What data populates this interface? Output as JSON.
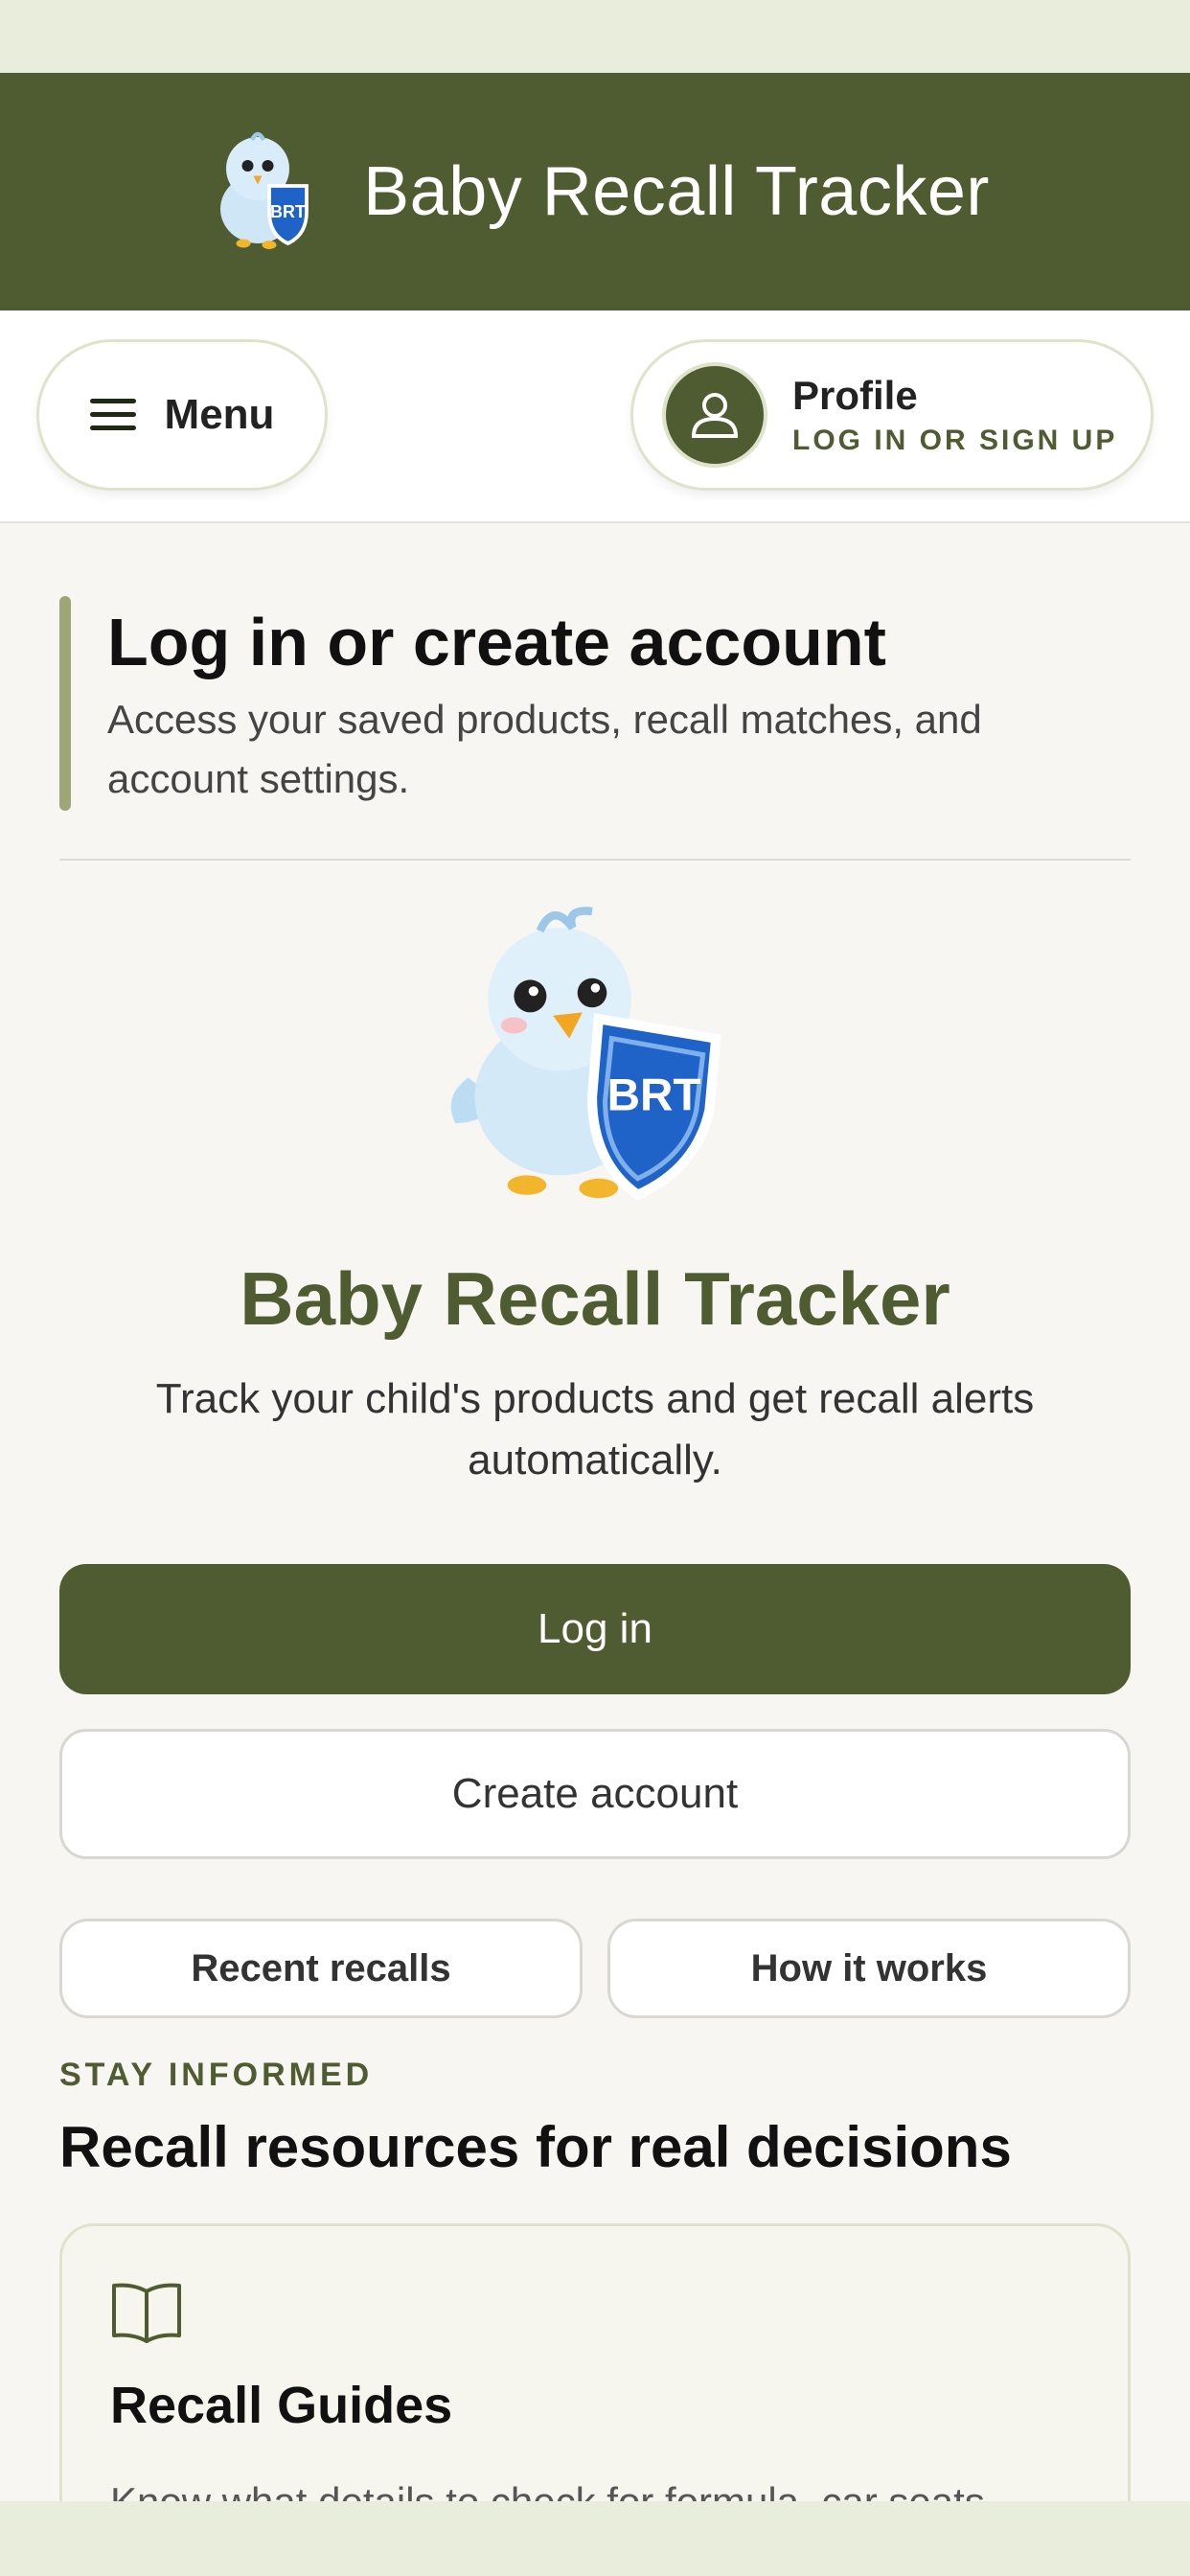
{
  "header": {
    "app_title": "Baby Recall Tracker",
    "logo_text": "BRT"
  },
  "nav": {
    "menu_label": "Menu",
    "profile_title": "Profile",
    "profile_subtitle": "LOG IN OR SIGN UP"
  },
  "intro": {
    "heading": "Log in or create account",
    "description": "Access your saved products, recall matches, and account settings."
  },
  "brand": {
    "name": "Baby Recall Tracker",
    "tagline": "Track your child's products and get recall alerts automatically.",
    "mascot_text": "BRT"
  },
  "actions": {
    "login_label": "Log in",
    "create_label": "Create account",
    "recent_label": "Recent recalls",
    "how_label": "How it works"
  },
  "resources": {
    "eyebrow": "STAY INFORMED",
    "title": "Recall resources for real decisions",
    "card": {
      "icon": "book-open-icon",
      "title": "Recall Guides",
      "text": "Know what details to check for formula, car seats"
    }
  },
  "colors": {
    "primary": "#4f5b30",
    "accent_bar": "#9ca676",
    "background": "#f7f6f3",
    "status_bar": "#e9eddc"
  }
}
